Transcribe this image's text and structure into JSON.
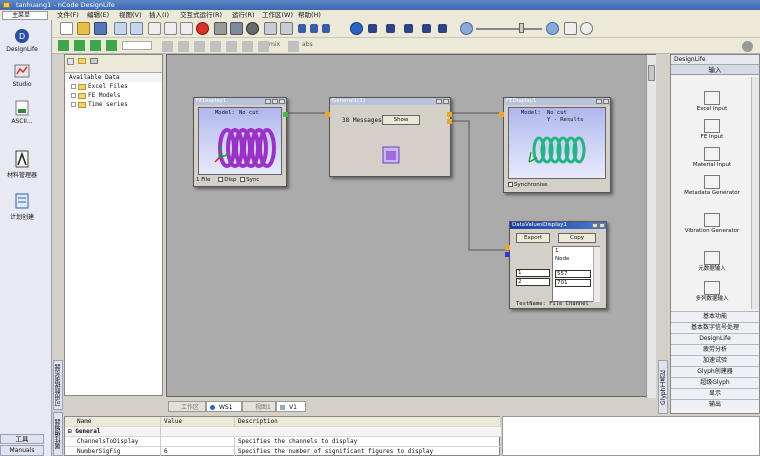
{
  "window": {
    "title": "tanhuang1 - nCode DesignLife"
  },
  "menubar": {
    "main_menu": "主菜单",
    "items": [
      "文件(F)",
      "编辑(E)",
      "视图(V)",
      "插入(I)",
      "交互式运行(R)",
      "运行(R)",
      "工作区(W)",
      "帮助(H)"
    ]
  },
  "toolbar": {
    "mix_label": "mix",
    "abs_label": "abs"
  },
  "left_rail": {
    "items": [
      "DesignLife",
      "Studio",
      "ASCII...",
      "材料管理器",
      "计划创建"
    ],
    "bottom": [
      "工具",
      "Manuals"
    ]
  },
  "tree": {
    "header": "Available Data",
    "items": [
      "Excel Files",
      "FE Models",
      "Time series"
    ]
  },
  "vertical_tabs": {
    "left_upper": "可用数据浏览器",
    "left_lower": "属性编辑器",
    "right": "Glyph工具栏"
  },
  "glyphs": {
    "fe_display_1": {
      "title": "FEDisplay1",
      "model_label": "Model:",
      "model_value": "No cut",
      "footer_file": "1 File",
      "footer_disp": "Disp",
      "footer_sync": "Sync"
    },
    "general_glyph": {
      "title": "General1(1)",
      "messages": "38 Messages",
      "show_button": "Show"
    },
    "fe_display_2": {
      "title": "FEDisplay1",
      "model_label": "Model:",
      "model_value": "No cut",
      "results_label": "Y - Results",
      "sync_label": "Synchronise"
    },
    "data_values": {
      "title": "DataValuesDisplay1",
      "export_button": "Export",
      "copy_button": "Copy",
      "header_value": "1",
      "header_node": "Node",
      "rows": [
        {
          "index": "1",
          "value": "557"
        },
        {
          "index": "2",
          "value": "701"
        }
      ],
      "footer": "TestName: File  Channel"
    }
  },
  "palette": {
    "header": "DesignLife",
    "active_tab": "输入",
    "items": [
      "Excel Input",
      "FE Input",
      "Material Input",
      "Metadata Generator",
      "Vibration Generator",
      "元数据输入",
      "多列数据输入"
    ],
    "tabs": [
      "基本功能",
      "基本数字信号处理",
      "DesignLife",
      "疲劳分析",
      "加速试验",
      "Glyph创建器",
      "超级Glyph",
      "显示",
      "输出"
    ]
  },
  "bottom_tabs": [
    "工作区",
    "WS1",
    "视图1",
    "V1"
  ],
  "properties": {
    "columns": [
      "Name",
      "Value",
      "Description"
    ],
    "section": "General",
    "rows": [
      {
        "name": "ChannelsToDisplay",
        "value": "",
        "description": "Specifies the channels to display"
      },
      {
        "name": "NumberSigFig",
        "value": "6",
        "description": "Specifies the number of significant figures to display"
      }
    ]
  },
  "colors": {
    "title_bar": "#3a68b0",
    "workspace": "#ababab",
    "active_glyph_title": "#1d3e9b",
    "spring": "#9b32c8",
    "spring_result": "#22b583"
  }
}
